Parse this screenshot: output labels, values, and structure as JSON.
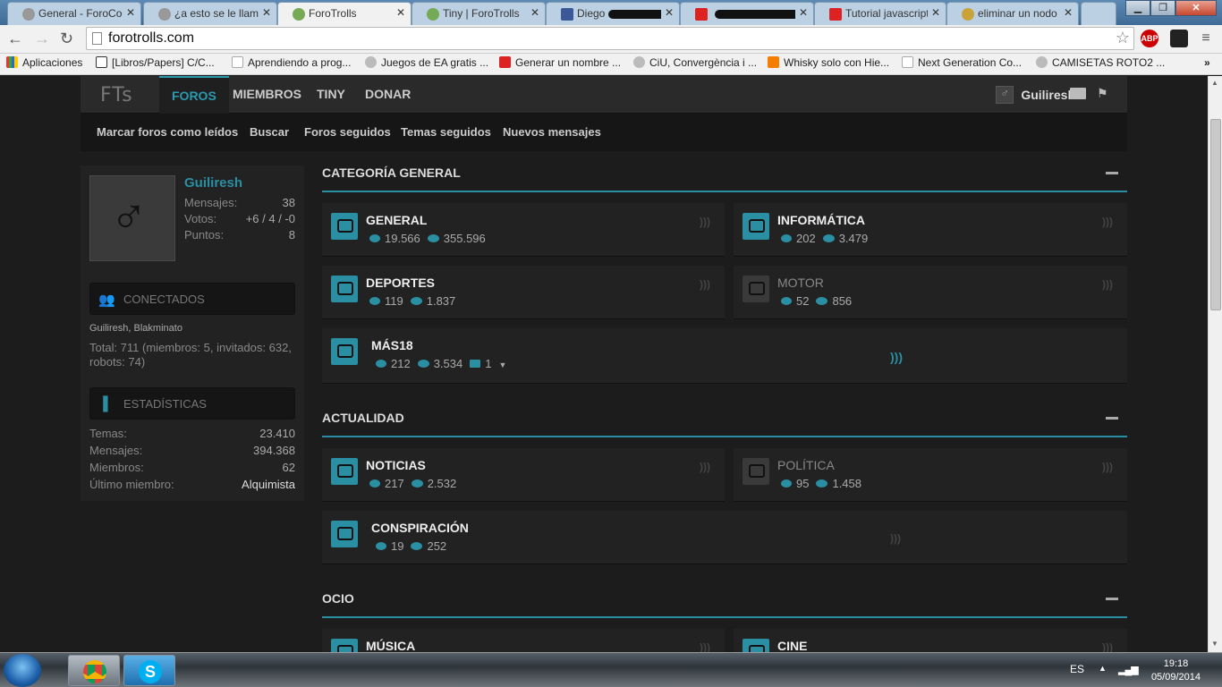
{
  "browser": {
    "tabs": [
      {
        "title": "General - ForoCoc",
        "active": false
      },
      {
        "title": "¿a esto se le llama",
        "active": false
      },
      {
        "title": "ForoTrolls",
        "active": true
      },
      {
        "title": "Tiny | ForoTrolls",
        "active": false
      },
      {
        "title": "Diego",
        "active": false
      },
      {
        "title": "",
        "active": false
      },
      {
        "title": "Tutorial javascript",
        "active": false
      },
      {
        "title": "eliminar un nodo",
        "active": false
      }
    ],
    "url": "forotrolls.com",
    "extensions": [
      "ABP"
    ],
    "bookmarks": [
      "Aplicaciones",
      "[Libros/Papers] C/C...",
      "Aprendiendo a prog...",
      "Juegos de EA gratis ...",
      "Generar un nombre ...",
      "CiU, Convergència i ...",
      "Whisky solo con Hie...",
      "Next Generation Co...",
      "CAMISETAS ROTO2 ..."
    ]
  },
  "site": {
    "logo": "FTs",
    "menu": [
      "FOROS",
      "MIEMBROS",
      "TINY",
      "DONAR"
    ],
    "active_menu": "FOROS",
    "username": "Guiliresh",
    "subnav": [
      "Marcar foros como leídos",
      "Buscar",
      "Foros seguidos",
      "Temas seguidos",
      "Nuevos mensajes"
    ]
  },
  "sidebar": {
    "username": "Guiliresh",
    "user_stats": [
      {
        "label": "Mensajes:",
        "value": "38"
      },
      {
        "label": "Votos:",
        "value": "+6 / 4 / -0"
      },
      {
        "label": "Puntos:",
        "value": "8"
      }
    ],
    "online_title": "CONECTADOS",
    "online_users": "Guiliresh, Blakminato",
    "online_total": "Total: 711 (miembros: 5, invitados: 632, robots: 74)",
    "stats_title": "ESTADÍSTICAS",
    "stats": [
      {
        "label": "Temas:",
        "value": "23.410"
      },
      {
        "label": "Mensajes:",
        "value": "394.368"
      },
      {
        "label": "Miembros:",
        "value": "62"
      },
      {
        "label": "Último miembro:",
        "value": "Alquimista"
      }
    ]
  },
  "categories": [
    {
      "title": "CATEGORÍA GENERAL",
      "forums": [
        {
          "name": "GENERAL",
          "threads": "19.566",
          "posts": "355.596",
          "dim": false
        },
        {
          "name": "INFORMÁTICA",
          "threads": "202",
          "posts": "3.479",
          "dim": false
        },
        {
          "name": "DEPORTES",
          "threads": "119",
          "posts": "1.837",
          "dim": false
        },
        {
          "name": "MOTOR",
          "threads": "52",
          "posts": "856",
          "dim": true
        },
        {
          "name": "MÁS18",
          "threads": "212",
          "posts": "3.534",
          "subforums": "1",
          "dim": false
        }
      ]
    },
    {
      "title": "ACTUALIDAD",
      "forums": [
        {
          "name": "NOTICIAS",
          "threads": "217",
          "posts": "2.532",
          "dim": false
        },
        {
          "name": "POLÍTICA",
          "threads": "95",
          "posts": "1.458",
          "dim": true
        },
        {
          "name": "CONSPIRACIÓN",
          "threads": "19",
          "posts": "252",
          "dim": false
        }
      ]
    },
    {
      "title": "OCIO",
      "forums": [
        {
          "name": "MÚSICA",
          "dim": false
        },
        {
          "name": "CINE",
          "dim": false
        }
      ]
    }
  ],
  "taskbar": {
    "language": "ES",
    "time": "19:18",
    "date": "05/09/2014"
  },
  "colors": {
    "accent": "#2a8fa3",
    "page_bg": "#1c1c1c",
    "panel_bg": "#222222"
  }
}
